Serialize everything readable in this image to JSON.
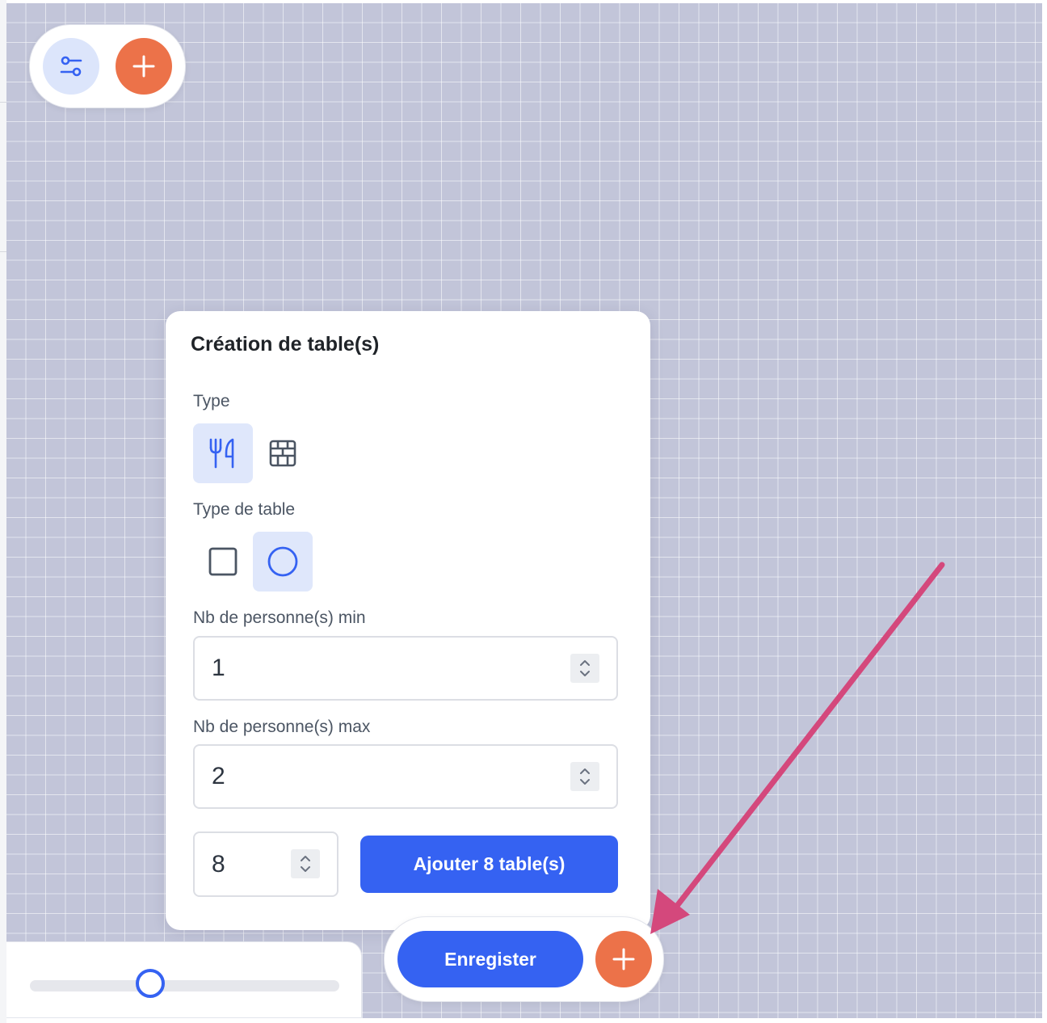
{
  "panel": {
    "title": "Création de table(s)",
    "type_label": "Type",
    "type_options": [
      {
        "icon": "utensils-icon",
        "selected": true
      },
      {
        "icon": "brick-wall-icon",
        "selected": false
      }
    ],
    "table_type_label": "Type de table",
    "table_type_options": [
      {
        "icon": "square-icon",
        "selected": false
      },
      {
        "icon": "circle-icon",
        "selected": true
      }
    ],
    "min_label": "Nb de personne(s) min",
    "min_value": "1",
    "max_label": "Nb de personne(s) max",
    "max_value": "2",
    "count_value": "8",
    "add_button_label": "Ajouter 8 table(s)"
  },
  "toolbar_top": {
    "filter_icon": "sliders-icon",
    "add_icon": "plus-icon"
  },
  "toolbar_bottom": {
    "save_label": "Enregister",
    "add_icon": "plus-icon"
  },
  "zoom": {
    "level": 0.39
  },
  "colors": {
    "accent_blue": "#3562f2",
    "accent_orange": "#ec7249",
    "canvas_bg": "#c2c5d9",
    "selected_bg": "#dfe7fb",
    "annotation_arrow": "#d4487c"
  }
}
